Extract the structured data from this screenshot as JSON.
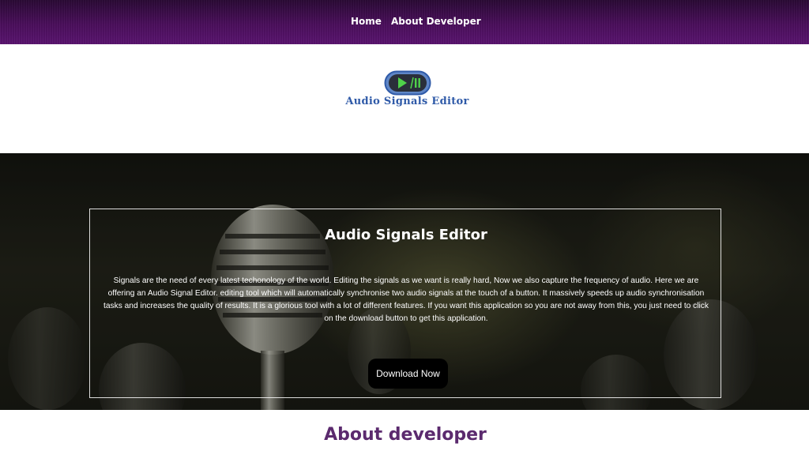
{
  "nav": {
    "items": [
      {
        "label": "Home"
      },
      {
        "label": "About Developer"
      }
    ]
  },
  "logo": {
    "icon": "play-pause-icon",
    "text": "Audio Signals Editor"
  },
  "hero": {
    "title": "Audio Signals Editor",
    "description": "Signals are the need of every latest techonology of the world. Editing the signals as we want is really hard, Now we also capture the frequency of audio. Here we are offering an Audio Signal Editor. editing tool which will automatically synchronise two audio signals at the touch of a button. It massively speeds up audio synchronisation tasks and increases the quality of results. It is a glorious tool with a lot of different features. If you want this application so you are not away from this, you just need to click on the download button to get this application.",
    "download_label": "Download Now"
  },
  "about": {
    "heading": "About developer"
  },
  "colors": {
    "nav_bg": "#4b0f5c",
    "logo_text": "#2f5aa8",
    "about_heading": "#5b2a6e",
    "button_bg": "#000000"
  }
}
